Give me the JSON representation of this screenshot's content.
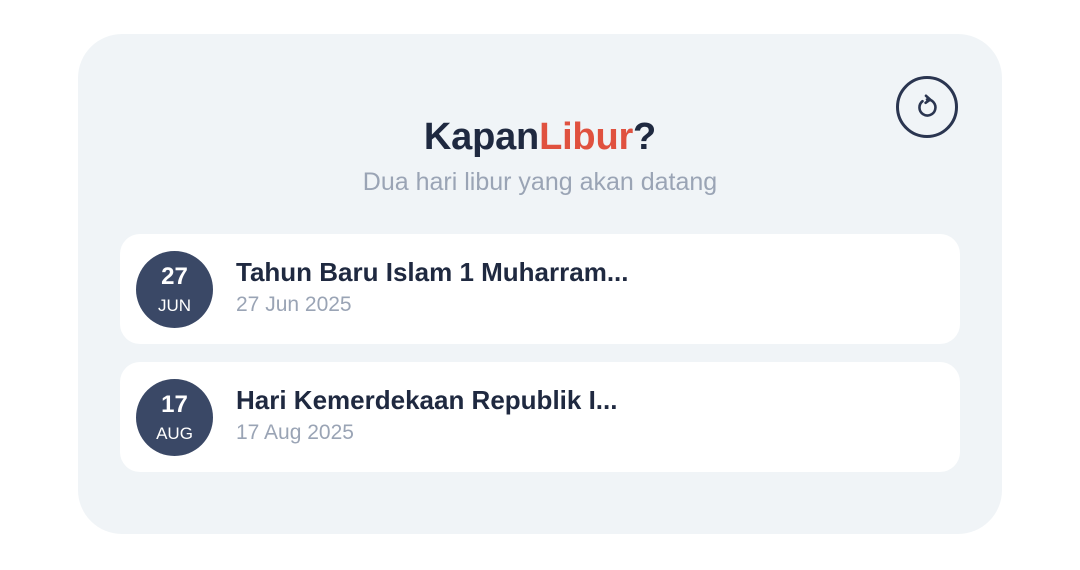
{
  "header": {
    "title_main": "Kapan",
    "title_accent": "Libur",
    "title_suffix": "?",
    "refresh_icon": "refresh-icon",
    "subtitle": "Dua hari libur yang akan datang"
  },
  "holidays": [
    {
      "day": "27",
      "month": "JUN",
      "name": "Tahun Baru Islam 1 Muharram...",
      "date": "27 Jun 2025"
    },
    {
      "day": "17",
      "month": "AUG",
      "name": "Hari Kemerdekaan Republik I...",
      "date": "17 Aug 2025"
    }
  ],
  "colors": {
    "accent": "#e0513f",
    "title": "#1f2940",
    "muted": "#9aa4b5",
    "badge": "#3a4866",
    "panel": "#f0f4f7"
  }
}
